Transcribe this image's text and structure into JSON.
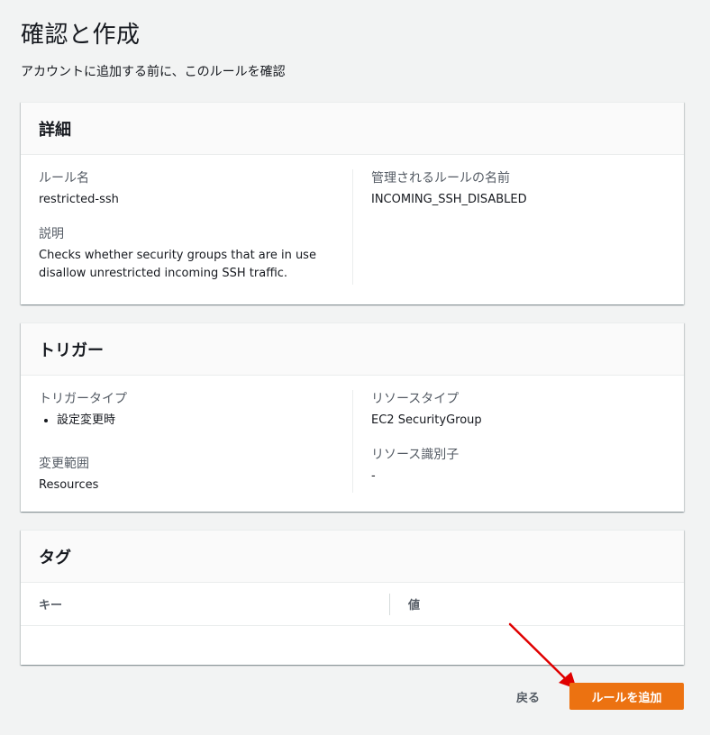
{
  "page": {
    "title": "確認と作成",
    "subtitle": "アカウントに追加する前に、このルールを確認"
  },
  "details": {
    "header": "詳細",
    "rule_name_label": "ルール名",
    "rule_name_value": "restricted-ssh",
    "description_label": "説明",
    "description_value": "Checks whether security groups that are in use disallow unrestricted incoming SSH traffic.",
    "managed_rule_label": "管理されるルールの名前",
    "managed_rule_value": "INCOMING_SSH_DISABLED"
  },
  "trigger": {
    "header": "トリガー",
    "trigger_type_label": "トリガータイプ",
    "trigger_types": [
      "設定変更時"
    ],
    "scope_label": "変更範囲",
    "scope_value": "Resources",
    "resource_type_label": "リソースタイプ",
    "resource_type_value": "EC2 SecurityGroup",
    "resource_id_label": "リソース識別子",
    "resource_id_value": "-"
  },
  "tags": {
    "header": "タグ",
    "columns": [
      "キー",
      "値"
    ],
    "rows": []
  },
  "actions": {
    "back_label": "戻る",
    "add_label": "ルールを追加"
  },
  "colors": {
    "primary_button": "#ec7211",
    "annotation_arrow": "#e00000"
  }
}
